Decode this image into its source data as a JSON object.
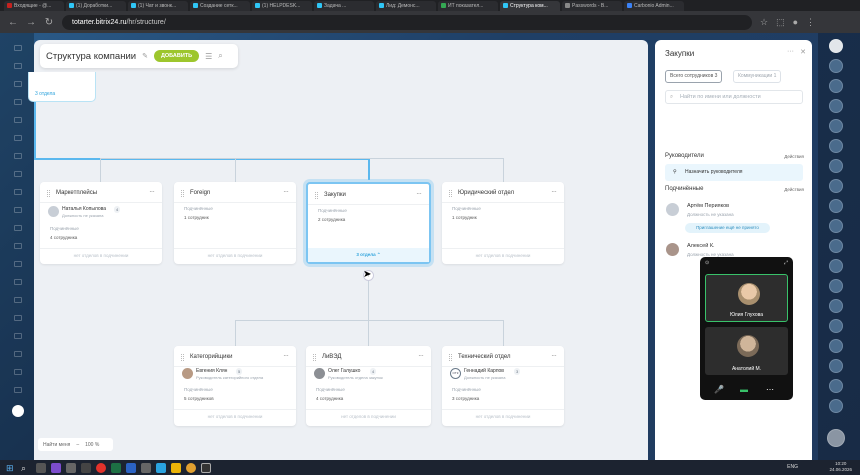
{
  "browser": {
    "tabs": [
      {
        "label": "Входящие - @...",
        "color": "#c5221f"
      },
      {
        "label": "(1) Доработки...",
        "color": "#2fc6f6"
      },
      {
        "label": "(1) Чат и звонк...",
        "color": "#2fc6f6"
      },
      {
        "label": "Создание сетк...",
        "color": "#2fc6f6"
      },
      {
        "label": "(1) HELPDESK...",
        "color": "#2fc6f6"
      },
      {
        "label": "Задача ...",
        "color": "#2fc6f6"
      },
      {
        "label": "Лид: Демонс...",
        "color": "#2fc6f6"
      },
      {
        "label": "ИТ показател...",
        "color": "#34a853"
      },
      {
        "label": "Структура ком...",
        "color": "#2fc6f6",
        "active": true
      },
      {
        "label": "Passwords - B...",
        "color": "#888888"
      },
      {
        "label": "Carbonio Admin...",
        "color": "#3b82f6"
      }
    ],
    "url_host": "totarter.bitrix24.ru",
    "url_path": "/hr/structure/"
  },
  "page": {
    "title": "Структура компании",
    "add_button": "ДОБАВИТЬ",
    "top_node_toggle": "3 отдела",
    "zoom_toggle": "Найти меня",
    "zoom_value": "100 %"
  },
  "departments_row1": [
    {
      "name": "Маркетплейсы",
      "person": "Наталья Копылова",
      "position": "Должность не указана",
      "badge": "4",
      "sub_label": "Подчинённые",
      "sub_count": "4 сотрудника",
      "footer": "нет отделов в подчинении"
    },
    {
      "name": "Foreign",
      "sub_label": "Подчинённые",
      "sub_count": "1 сотрудник",
      "footer": "нет отделов в подчинении"
    },
    {
      "name": "Закупки",
      "sub_label": "Подчинённые",
      "sub_count": "2 сотрудника",
      "footer": "3 отдела"
    },
    {
      "name": "Юридический отдел",
      "sub_label": "Подчинённые",
      "sub_count": "1 сотрудник",
      "footer": "нет отделов в подчинении"
    }
  ],
  "departments_row2": [
    {
      "name": "Категорийщики",
      "person": "Евгения Клян",
      "position": "Руководитель категорийного отдела",
      "badge": "5",
      "sub_label": "Подчинённые",
      "sub_count": "5 сотрудников",
      "footer": "нет отделов в подчинении"
    },
    {
      "name": "ЛиВЭД",
      "person": "Олег Галушко",
      "position": "Руководитель отдела закупок",
      "badge": "4",
      "sub_label": "Подчинённые",
      "sub_count": "4 сотрудника",
      "footer": "нет отделов в подчинении"
    },
    {
      "name": "Технический отдел",
      "person": "Геннадий Карпов",
      "position": "Должность не указана",
      "badge": "3",
      "avatar_text": "ОТК",
      "sub_label": "Подчинённые",
      "sub_count": "3 сотрудника",
      "footer": "нет отделов в подчинении"
    }
  ],
  "panel": {
    "title": "Закупки",
    "tab_all": "Всего сотрудников 3",
    "tab_comm": "Коммуникации 1",
    "search_placeholder": "Найти по имени или должности",
    "heads_label": "Руководители",
    "heads_action": "Действия",
    "assign_label": "Назначить руководителя",
    "subs_label": "Подчинённые",
    "subs_action": "Действия",
    "employees": [
      {
        "name": "Артём Перияков",
        "position": "Должность не указана"
      },
      {
        "name": "Алексей К.",
        "position": "Должность не указана"
      }
    ],
    "invite_label": "Приглашение ещё не принято"
  },
  "video_call": {
    "participants": [
      {
        "name": "Юлия Глухова",
        "active": true
      },
      {
        "name": "Анатолий М.",
        "active": false
      }
    ]
  },
  "taskbar": {
    "lang": "ENG",
    "time": "10:20",
    "date": "24.06.2026"
  }
}
